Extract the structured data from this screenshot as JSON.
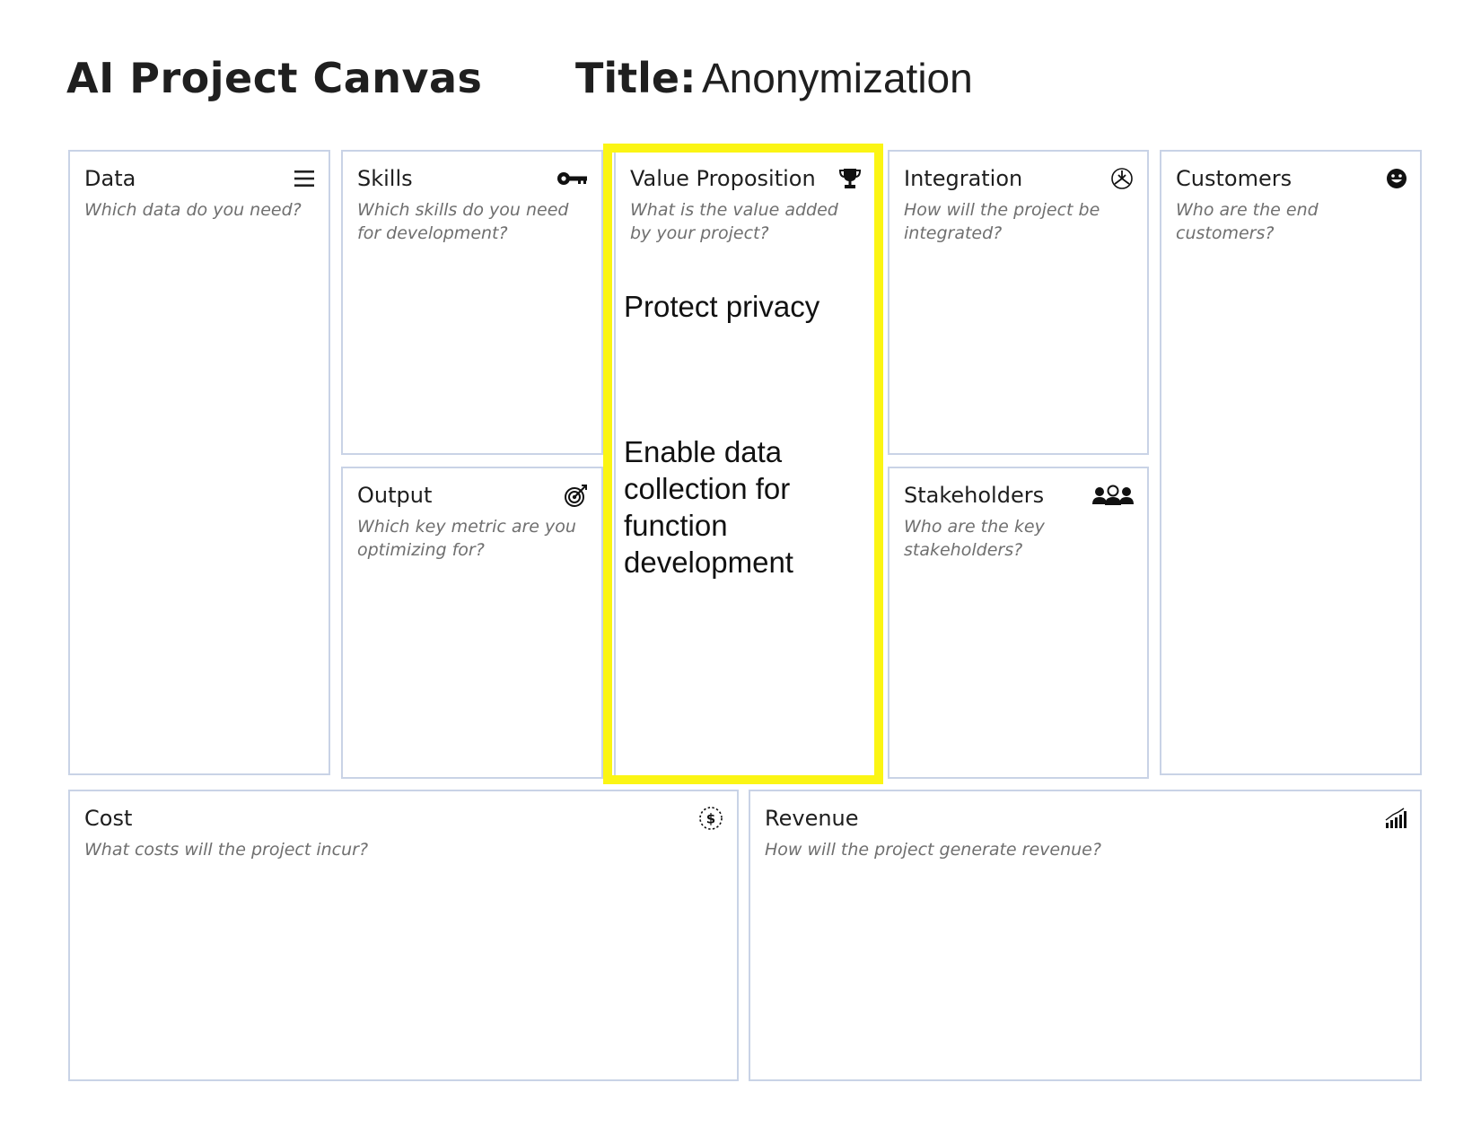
{
  "header": {
    "canvas_title": "AI Project Canvas",
    "title_label": "Title:",
    "title_value": "Anonymization"
  },
  "boxes": {
    "data": {
      "title": "Data",
      "prompt": "Which data do you need?",
      "icon": "list-icon"
    },
    "skills": {
      "title": "Skills",
      "prompt": "Which skills do you need for development?",
      "icon": "key-icon"
    },
    "output": {
      "title": "Output",
      "prompt": "Which key metric are you optimizing for?",
      "icon": "target-icon"
    },
    "value_proposition": {
      "title": "Value Proposition",
      "prompt": "What is the value added by your project?",
      "icon": "trophy-icon",
      "notes": [
        "Protect privacy",
        "Enable data collection for function development"
      ]
    },
    "integration": {
      "title": "Integration",
      "prompt": "How will the project be integrated?",
      "icon": "integration-icon"
    },
    "stakeholders": {
      "title": "Stakeholders",
      "prompt": "Who are the key stakeholders?",
      "icon": "people-icon"
    },
    "customers": {
      "title": "Customers",
      "prompt": "Who are the end customers?",
      "icon": "smiley-icon"
    },
    "cost": {
      "title": "Cost",
      "prompt": "What costs will the project incur?",
      "icon": "dollar-icon"
    },
    "revenue": {
      "title": "Revenue",
      "prompt": "How will the project generate revenue?",
      "icon": "bar-chart-icon"
    }
  },
  "colors": {
    "box_border": "#c9d3e6",
    "highlight": "#fbf514",
    "prompt_text": "#6f6f6f"
  }
}
